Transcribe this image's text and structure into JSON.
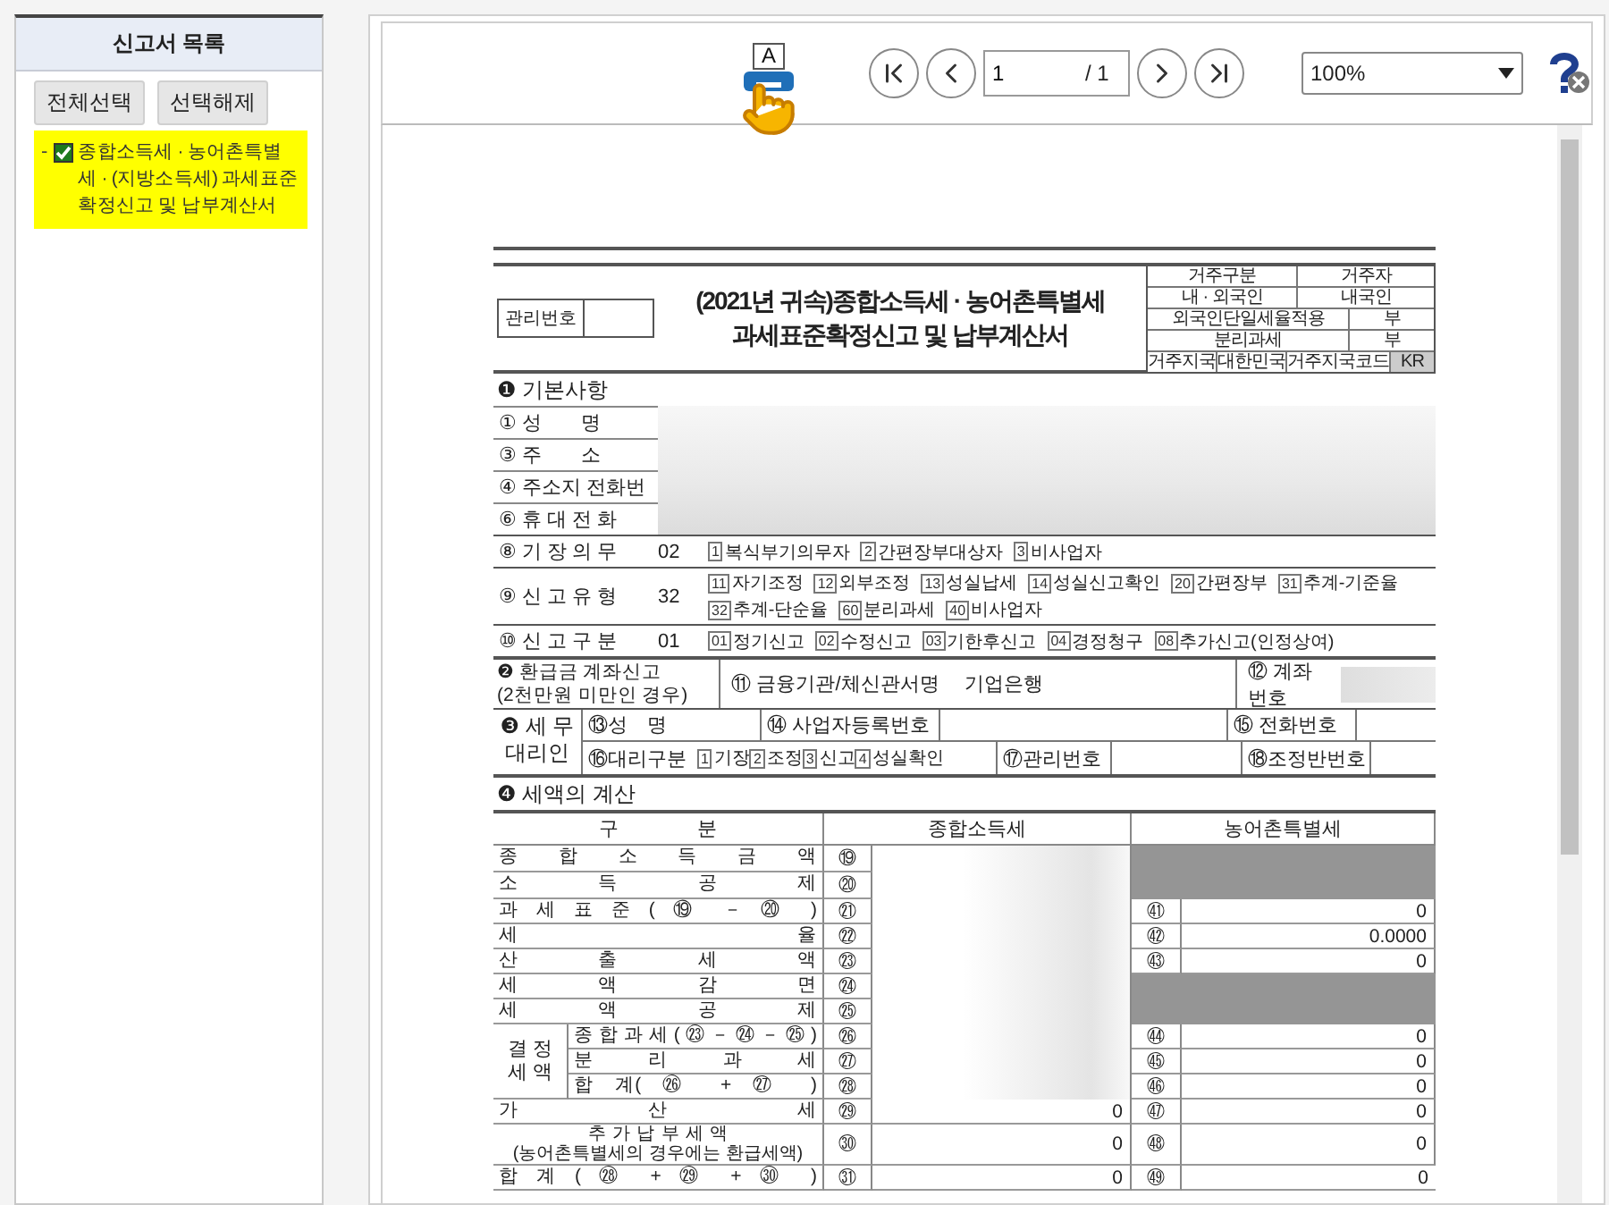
{
  "sidebar": {
    "title": "신고서 목록",
    "buttons": [
      "전체선택",
      "선택해제"
    ],
    "items": [
      {
        "bullet": "-",
        "label": "종합소득세 · 농어촌특별세 · (지방소득세) 과세표준확정신고 및 납부계산서",
        "checked": true,
        "selected": true
      }
    ]
  },
  "viewer": {
    "print_label": "A",
    "page": "1",
    "page_total": "/ 1",
    "zoom": "100%"
  },
  "form": {
    "id_label": "관리번호",
    "title": [
      "(2021년 귀속)종합소득세 · 농어촌특별세",
      "과세표준확정신고 및 납부계산서"
    ],
    "residency": [
      [
        "거주구분",
        "거주자"
      ],
      [
        "내 · 외국인",
        "내국인"
      ],
      [
        "외국인단일세율적용",
        "부"
      ],
      [
        "분리과세",
        "부"
      ],
      [
        "거주지국",
        "대한민국",
        "거주지국코드",
        "KR"
      ]
    ],
    "basic": {
      "title": "❶ 기본사항",
      "fields": [
        "① 성　　명",
        "③ 주　　소",
        "④ 주소지 전화번",
        "⑥ 휴 대 전 화"
      ],
      "option_rows": [
        {
          "label": "⑧ 기 장 의 무",
          "code": "02",
          "options": [
            {
              "code": "1",
              "text": "복식부기의무자"
            },
            {
              "code": "2",
              "text": "간편장부대상자"
            },
            {
              "code": "3",
              "text": "비사업자"
            }
          ]
        },
        {
          "label": "⑨ 신 고 유 형",
          "code": "32",
          "options": [
            {
              "code": "11",
              "text": "자기조정"
            },
            {
              "code": "12",
              "text": "외부조정"
            },
            {
              "code": "13",
              "text": "성실납세"
            },
            {
              "code": "14",
              "text": "성실신고확인"
            },
            {
              "code": "20",
              "text": "간편장부"
            },
            {
              "code": "31",
              "text": "추계-기준율"
            },
            {
              "code": "32",
              "text": "추계-단순율"
            },
            {
              "code": "60",
              "text": "분리과세"
            },
            {
              "code": "40",
              "text": "비사업자"
            }
          ]
        },
        {
          "label": "⑩ 신 고 구 분",
          "code": "01",
          "options": [
            {
              "code": "01",
              "text": "정기신고"
            },
            {
              "code": "02",
              "text": "수정신고"
            },
            {
              "code": "03",
              "text": "기한후신고"
            },
            {
              "code": "04",
              "text": "경정청구"
            },
            {
              "code": "08",
              "text": "추가신고(인정상여)"
            }
          ]
        }
      ]
    },
    "refund": {
      "title": "❷ 환급금 계좌신고",
      "subtitle": "(2천만원 미만인 경우)",
      "bank_label": "⑪ 금융기관/체신관서명",
      "bank": "기업은행",
      "account_label": "⑫ 계좌번호"
    },
    "agent": {
      "title": [
        "❸ 세 무",
        "대리인"
      ],
      "name_label": "⑬성　명",
      "bizno_label": "⑭ 사업자등록번호",
      "phone_label": "⑮ 전화번호",
      "type_label": "⑯대리구분",
      "type_options": [
        {
          "code": "1",
          "text": "기장"
        },
        {
          "code": "2",
          "text": "조정"
        },
        {
          "code": "3",
          "text": "신고"
        },
        {
          "code": "4",
          "text": "성실확인"
        }
      ],
      "mgmt_label": "⑰관리번호",
      "team_label": "⑱조정반번호"
    },
    "tax": {
      "title": "❹ 세액의 계산",
      "columns": [
        "구　　　　분",
        "종합소득세",
        "농어촌특별세"
      ],
      "group_label": "결 정 세 액",
      "rows": [
        {
          "label": "종 합 소 득 금 액",
          "num": "⑲",
          "sub": false,
          "income": {
            "kind": "blurred"
          },
          "rural": {
            "kind": "shaded"
          }
        },
        {
          "label": "소 득 공 제",
          "num": "⑳",
          "sub": false,
          "income": {
            "kind": "blurred"
          },
          "rural": {
            "kind": "shaded"
          }
        },
        {
          "label": "과 세 표 준 ( ⑲ － ⑳ )",
          "num": "㉑",
          "sub": false,
          "income": {
            "kind": "blurred"
          },
          "rural": {
            "kind": "value",
            "num": "㊶",
            "value": "0"
          }
        },
        {
          "label": "세 율",
          "num": "㉒",
          "sub": false,
          "income": {
            "kind": "blurred"
          },
          "rural": {
            "kind": "value",
            "num": "㊷",
            "value": "0.0000"
          }
        },
        {
          "label": "산 출 세 액",
          "num": "㉓",
          "sub": false,
          "income": {
            "kind": "blurred"
          },
          "rural": {
            "kind": "value",
            "num": "㊸",
            "value": "0"
          }
        },
        {
          "label": "세 액 감 면",
          "num": "㉔",
          "sub": false,
          "income": {
            "kind": "blurred"
          },
          "rural": {
            "kind": "shaded"
          }
        },
        {
          "label": "세 액 공 제",
          "num": "㉕",
          "sub": false,
          "income": {
            "kind": "blurred"
          },
          "rural": {
            "kind": "shaded"
          }
        },
        {
          "label": "종 합 과 세 ( ㉓ － ㉔ － ㉕ )",
          "num": "㉖",
          "sub": true,
          "income": {
            "kind": "blurred"
          },
          "rural": {
            "kind": "value",
            "num": "㊹",
            "value": "0"
          }
        },
        {
          "label": "분 리 과 세",
          "num": "㉗",
          "sub": true,
          "income": {
            "kind": "blurred"
          },
          "rural": {
            "kind": "value",
            "num": "㊺",
            "value": "0"
          }
        },
        {
          "label": "합 계( ㉖ + ㉗ )",
          "num": "㉘",
          "sub": true,
          "income": {
            "kind": "blurred"
          },
          "rural": {
            "kind": "value",
            "num": "㊻",
            "value": "0"
          }
        },
        {
          "label": "가 산 세",
          "num": "㉙",
          "sub": false,
          "income": {
            "kind": "value",
            "value": "0"
          },
          "rural": {
            "kind": "value",
            "num": "㊼",
            "value": "0"
          }
        },
        {
          "label": "추 가 납 부 세 액",
          "note": "(농어촌특별세의 경우에는 환급세액)",
          "num": "㉚",
          "sub": false,
          "income": {
            "kind": "value",
            "value": "0"
          },
          "rural": {
            "kind": "value",
            "num": "㊽",
            "value": "0"
          }
        },
        {
          "label": "합 계 ( ㉘ + ㉙ + ㉚ )",
          "num": "㉛",
          "sub": false,
          "income": {
            "kind": "value",
            "value": "0"
          },
          "rural": {
            "kind": "value",
            "num": "㊾",
            "value": "0"
          }
        }
      ]
    }
  }
}
